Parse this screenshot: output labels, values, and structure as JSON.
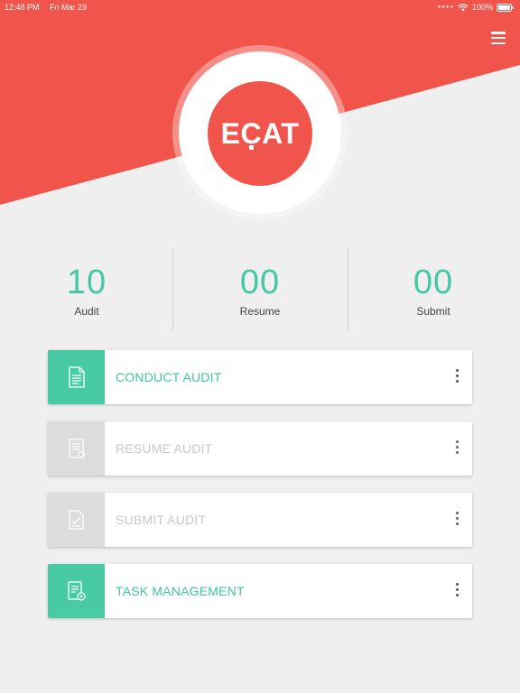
{
  "status_bar": {
    "time": "12:48 PM",
    "date": "Fri Mar 29",
    "battery": "100%",
    "icons": [
      "wifi-icon",
      "battery-icon"
    ]
  },
  "header": {
    "logo_text": "ECAT",
    "menu_icon": "hamburger-menu-icon"
  },
  "stats": [
    {
      "value": "10",
      "label": "Audit"
    },
    {
      "value": "00",
      "label": "Resume"
    },
    {
      "value": "00",
      "label": "Submit"
    }
  ],
  "actions": [
    {
      "label": "CONDUCT AUDIT",
      "icon": "audit-document-icon",
      "state": "active"
    },
    {
      "label": "RESUME AUDIT",
      "icon": "resume-document-icon",
      "state": "disabled"
    },
    {
      "label": "SUBMIT AUDIT",
      "icon": "submit-document-icon",
      "state": "disabled"
    },
    {
      "label": "TASK MANAGEMENT",
      "icon": "task-management-icon",
      "state": "active"
    }
  ],
  "colors": {
    "brand_red": "#f0544a",
    "accent_green": "#48cba5",
    "disabled_gray": "#dcdcdc",
    "background": "#efefef"
  }
}
